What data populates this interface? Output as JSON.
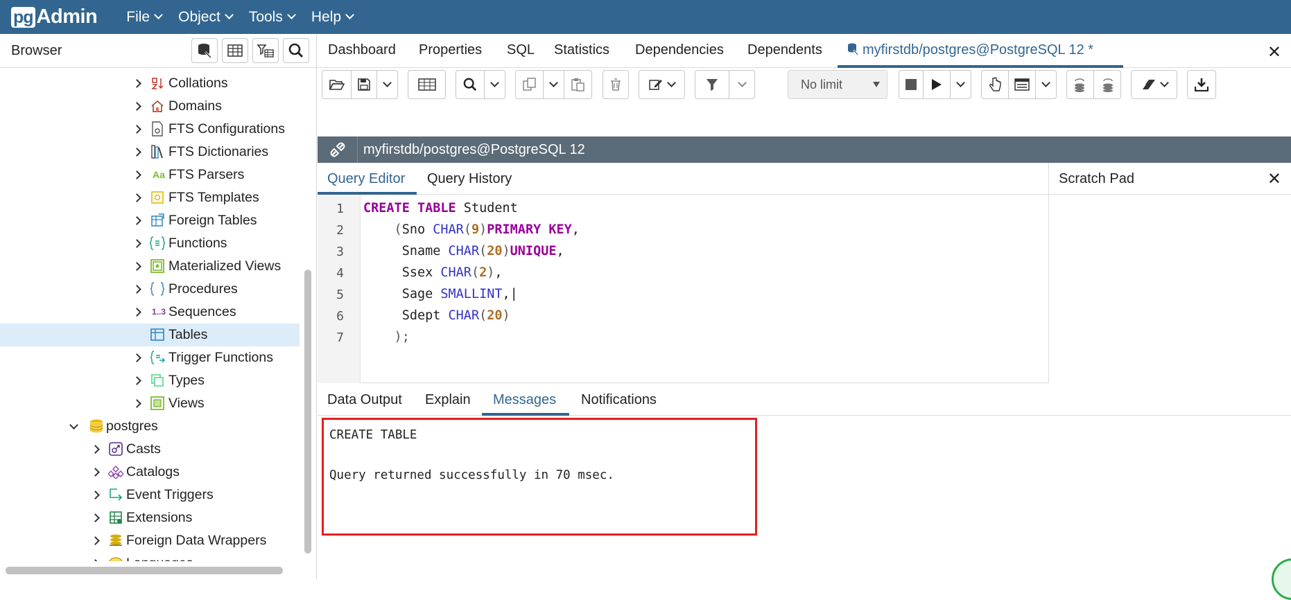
{
  "app": {
    "logo_pg": "pg",
    "logo_admin": "Admin"
  },
  "menu": [
    {
      "label": "File"
    },
    {
      "label": "Object"
    },
    {
      "label": "Tools"
    },
    {
      "label": "Help"
    }
  ],
  "browser": {
    "title": "Browser",
    "toolbar_icons": [
      "database-query-icon",
      "table-view-icon",
      "filter-table-icon",
      "search-icon"
    ],
    "tree": [
      {
        "label": "Collations",
        "icon": "collation-icon",
        "expand": "right"
      },
      {
        "label": "Domains",
        "icon": "domain-icon",
        "expand": "right"
      },
      {
        "label": "FTS Configurations",
        "icon": "fts-config-icon",
        "expand": "right"
      },
      {
        "label": "FTS Dictionaries",
        "icon": "fts-dictionary-icon",
        "expand": "right"
      },
      {
        "label": "FTS Parsers",
        "icon": "fts-parser-icon",
        "expand": "right",
        "icon_text": "Aa"
      },
      {
        "label": "FTS Templates",
        "icon": "fts-template-icon",
        "expand": "right"
      },
      {
        "label": "Foreign Tables",
        "icon": "foreign-table-icon",
        "expand": "right"
      },
      {
        "label": "Functions",
        "icon": "function-icon",
        "expand": "right"
      },
      {
        "label": "Materialized Views",
        "icon": "materialized-view-icon",
        "expand": "right"
      },
      {
        "label": "Procedures",
        "icon": "procedure-icon",
        "expand": "right"
      },
      {
        "label": "Sequences",
        "icon": "sequence-icon",
        "expand": "right",
        "icon_text": "1..3"
      },
      {
        "label": "Tables",
        "icon": "table-icon",
        "expand": "none",
        "selected": true
      },
      {
        "label": "Trigger Functions",
        "icon": "trigger-function-icon",
        "expand": "right"
      },
      {
        "label": "Types",
        "icon": "type-icon",
        "expand": "right"
      },
      {
        "label": "Views",
        "icon": "view-icon",
        "expand": "right"
      },
      {
        "label": "postgres",
        "icon": "database-icon",
        "expand": "down"
      },
      {
        "label": "Casts",
        "icon": "cast-icon",
        "expand": "right"
      },
      {
        "label": "Catalogs",
        "icon": "catalog-icon",
        "expand": "right"
      },
      {
        "label": "Event Triggers",
        "icon": "event-trigger-icon",
        "expand": "right"
      },
      {
        "label": "Extensions",
        "icon": "extension-icon",
        "expand": "right"
      },
      {
        "label": "Foreign Data Wrappers",
        "icon": "foreign-data-wrapper-icon",
        "expand": "right"
      },
      {
        "label": "Languages",
        "icon": "language-icon",
        "expand": "right"
      }
    ]
  },
  "main_tabs": [
    {
      "label": "Dashboard"
    },
    {
      "label": "Properties"
    },
    {
      "label": "SQL"
    },
    {
      "label": "Statistics"
    },
    {
      "label": "Dependencies"
    },
    {
      "label": "Dependents"
    },
    {
      "label": "myfirstdb/postgres@PostgreSQL 12 *",
      "active": true
    }
  ],
  "toolbar": {
    "limit_select": "No limit"
  },
  "connection": {
    "label": "myfirstdb/postgres@PostgreSQL 12"
  },
  "editor_tabs": [
    {
      "label": "Query Editor",
      "active": true
    },
    {
      "label": "Query History"
    }
  ],
  "scratch_pad": {
    "title": "Scratch Pad"
  },
  "code_lines": [
    [
      {
        "t": "CREATE",
        "c": "kw"
      },
      {
        "t": " "
      },
      {
        "t": "TABLE",
        "c": "kw"
      },
      {
        "t": " Student"
      }
    ],
    [
      {
        "t": "    (",
        "c": "pu"
      },
      {
        "t": "Sno "
      },
      {
        "t": "CHAR",
        "c": "ty"
      },
      {
        "t": "(",
        "c": "pu"
      },
      {
        "t": "9",
        "c": "nm"
      },
      {
        "t": ")",
        "c": "pu"
      },
      {
        "t": "PRIMARY",
        "c": "kw"
      },
      {
        "t": " "
      },
      {
        "t": "KEY",
        "c": "kw"
      },
      {
        "t": ","
      }
    ],
    [
      {
        "t": "     Sname "
      },
      {
        "t": "CHAR",
        "c": "ty"
      },
      {
        "t": "(",
        "c": "pu"
      },
      {
        "t": "20",
        "c": "nm"
      },
      {
        "t": ")",
        "c": "pu"
      },
      {
        "t": "UNIQUE",
        "c": "kw"
      },
      {
        "t": ","
      }
    ],
    [
      {
        "t": "     Ssex "
      },
      {
        "t": "CHAR",
        "c": "ty"
      },
      {
        "t": "(",
        "c": "pu"
      },
      {
        "t": "2",
        "c": "nm"
      },
      {
        "t": ")",
        "c": "pu"
      },
      {
        "t": ","
      }
    ],
    [
      {
        "t": "     Sage "
      },
      {
        "t": "SMALLINT",
        "c": "ty"
      },
      {
        "t": ",|"
      }
    ],
    [
      {
        "t": "     Sdept "
      },
      {
        "t": "CHAR",
        "c": "ty"
      },
      {
        "t": "(",
        "c": "pu"
      },
      {
        "t": "20",
        "c": "nm"
      },
      {
        "t": ")",
        "c": "pu"
      }
    ],
    [
      {
        "t": "    );",
        "c": "pu"
      }
    ]
  ],
  "line_numbers": [
    "1",
    "2",
    "3",
    "4",
    "5",
    "6",
    "7"
  ],
  "result_tabs": [
    {
      "label": "Data Output"
    },
    {
      "label": "Explain"
    },
    {
      "label": "Messages",
      "active": true
    },
    {
      "label": "Notifications"
    }
  ],
  "messages": {
    "line1": "CREATE TABLE",
    "line2": "Query returned successfully in 70 msec."
  },
  "colors": {
    "brand": "#326690",
    "highlight": "#e02020",
    "selected_row": "#dcecf9",
    "connection_bar": "#5b6b78"
  }
}
